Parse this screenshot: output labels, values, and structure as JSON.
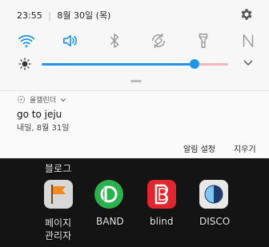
{
  "status_bar": {
    "time": "23:55",
    "separator": "|",
    "date": "8월 30일 (목)"
  },
  "quick_settings": {
    "tiles": [
      {
        "name": "wifi",
        "icon": "wifi-icon",
        "active": true
      },
      {
        "name": "sound",
        "icon": "volume-icon",
        "active": true
      },
      {
        "name": "bluetooth",
        "icon": "bluetooth-icon",
        "active": false
      },
      {
        "name": "auto-rotate",
        "icon": "auto-rotate-icon",
        "active": false
      },
      {
        "name": "flashlight",
        "icon": "flashlight-icon",
        "active": false
      },
      {
        "name": "nfc",
        "icon": "nfc-icon",
        "active": false
      }
    ],
    "brightness": 0.82,
    "accent_color": "#2196e9"
  },
  "notification": {
    "app_name": "올캘린더",
    "title": "go to jeju",
    "subtitle": "내일, 8월 31일",
    "actions": {
      "alarm_settings": "알림 설정",
      "clear": "지우기"
    }
  },
  "home_screen": {
    "partial_label_1": "블로그",
    "apps": [
      {
        "label_line1": "페이지",
        "label_line2": "관리자",
        "icon": "page-manager-icon"
      },
      {
        "label_line1": "BAND",
        "icon": "band-icon"
      },
      {
        "label_line1": "blind",
        "icon": "blind-icon"
      },
      {
        "label_line1": "DISCO",
        "icon": "disco-icon"
      }
    ]
  }
}
